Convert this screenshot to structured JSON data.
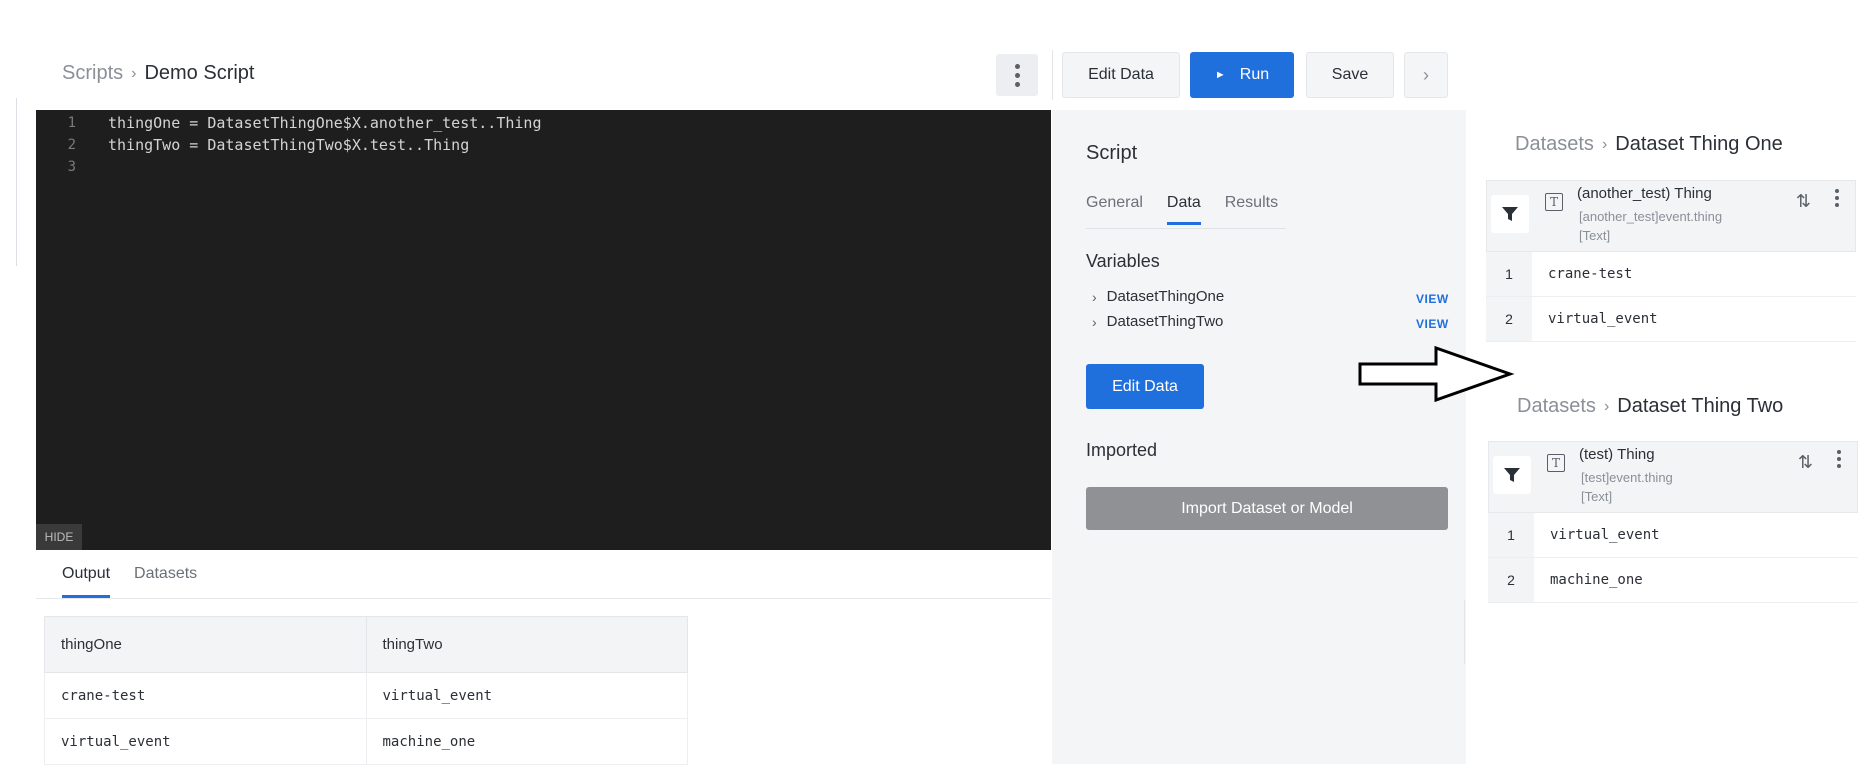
{
  "header": {
    "breadcrumb_parent": "Scripts",
    "breadcrumb_sep": "›",
    "breadcrumb_current": "Demo Script",
    "edit_data_label": "Edit Data",
    "run_label": "Run",
    "run_icon": "►",
    "save_label": "Save",
    "expand_icon": "›"
  },
  "editor": {
    "lines": [
      {
        "num": "1",
        "code": "thingOne = DatasetThingOne$X.another_test..Thing"
      },
      {
        "num": "2",
        "code": "thingTwo = DatasetThingTwo$X.test..Thing"
      },
      {
        "num": "3",
        "code": ""
      }
    ],
    "hide_label": "HIDE"
  },
  "output": {
    "tabs": [
      "Output",
      "Datasets"
    ],
    "active_tab": "Output",
    "columns": [
      "thingOne",
      "thingTwo"
    ],
    "rows": [
      [
        "crane-test",
        "virtual_event"
      ],
      [
        "virtual_event",
        "machine_one"
      ]
    ]
  },
  "panel": {
    "title": "Script",
    "tabs": [
      "General",
      "Data",
      "Results"
    ],
    "active_tab": "Data",
    "variables_title": "Variables",
    "variables": [
      {
        "name": "DatasetThingOne",
        "action": "VIEW"
      },
      {
        "name": "DatasetThingTwo",
        "action": "VIEW"
      }
    ],
    "edit_data_label": "Edit Data",
    "imported_title": "Imported",
    "import_label": "Import Dataset or Model"
  },
  "datasets": [
    {
      "crumb_parent": "Datasets",
      "crumb_current": "Dataset Thing One",
      "column_title": "(another_test) Thing",
      "column_path": "[another_test]event.thing",
      "column_type": "[Text]",
      "rows": [
        {
          "num": "1",
          "value": "crane-test"
        },
        {
          "num": "2",
          "value": "virtual_event"
        }
      ]
    },
    {
      "crumb_parent": "Datasets",
      "crumb_current": "Dataset Thing Two",
      "column_title": "(test) Thing",
      "column_path": "[test]event.thing",
      "column_type": "[Text]",
      "rows": [
        {
          "num": "1",
          "value": "virtual_event"
        },
        {
          "num": "2",
          "value": "machine_one"
        }
      ]
    }
  ],
  "colors": {
    "accent": "#1f6fdc",
    "editor_bg": "#1e1e1e",
    "panel_bg": "#f4f5f7",
    "import_btn": "#8f9194"
  }
}
